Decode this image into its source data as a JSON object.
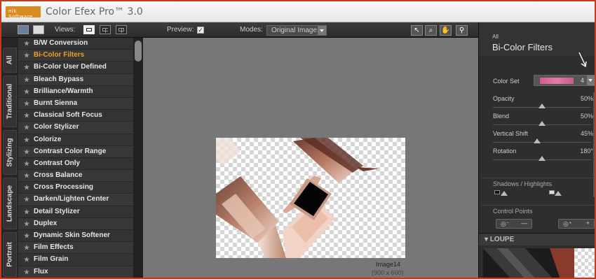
{
  "app": {
    "title": "Color Efex Pro™ 3.0",
    "logo_text": "nik Software"
  },
  "toolbar": {
    "views_label": "Views:",
    "preview_label": "Preview:",
    "preview_checked": true,
    "modes_label": "Modes:",
    "mode_value": "Original Image"
  },
  "vtabs": [
    "All",
    "Traditional",
    "Stylizing",
    "Landscape",
    "Portrait"
  ],
  "filters": [
    "B/W Conversion",
    "Bi-Color Filters",
    "Bi-Color User Defined",
    "Bleach Bypass",
    "Brilliance/Warmth",
    "Burnt Sienna",
    "Classical Soft Focus",
    "Color Stylizer",
    "Colorize",
    "Contrast Color Range",
    "Contrast Only",
    "Cross Balance",
    "Cross Processing",
    "Darken/Lighten Center",
    "Detail Stylizer",
    "Duplex",
    "Dynamic Skin Softener",
    "Film Effects",
    "Film Grain",
    "Flux"
  ],
  "selected_filter": "Bi-Color Filters",
  "preview": {
    "image_name": "Image14",
    "image_size": "(900 x 600)"
  },
  "panel": {
    "category": "All",
    "title": "Bi-Color Filters",
    "color_set_label": "Color Set",
    "color_set_value": "4",
    "sliders": [
      {
        "label": "Opacity",
        "value": "50%",
        "level": 0.5
      },
      {
        "label": "Blend",
        "value": "50%",
        "level": 0.5
      },
      {
        "label": "Vertical Shift",
        "value": "45%",
        "level": 0.45
      },
      {
        "label": "Rotation",
        "value": "180°",
        "level": 0.5
      }
    ],
    "shadows_highlights_label": "Shadows / Highlights",
    "control_points_label": "Control Points",
    "loupe_label": "LOUPE"
  },
  "colors": {
    "selected_filter": "#f0a020",
    "frame": "#c43a1a",
    "swatch": "#d65a8a"
  }
}
